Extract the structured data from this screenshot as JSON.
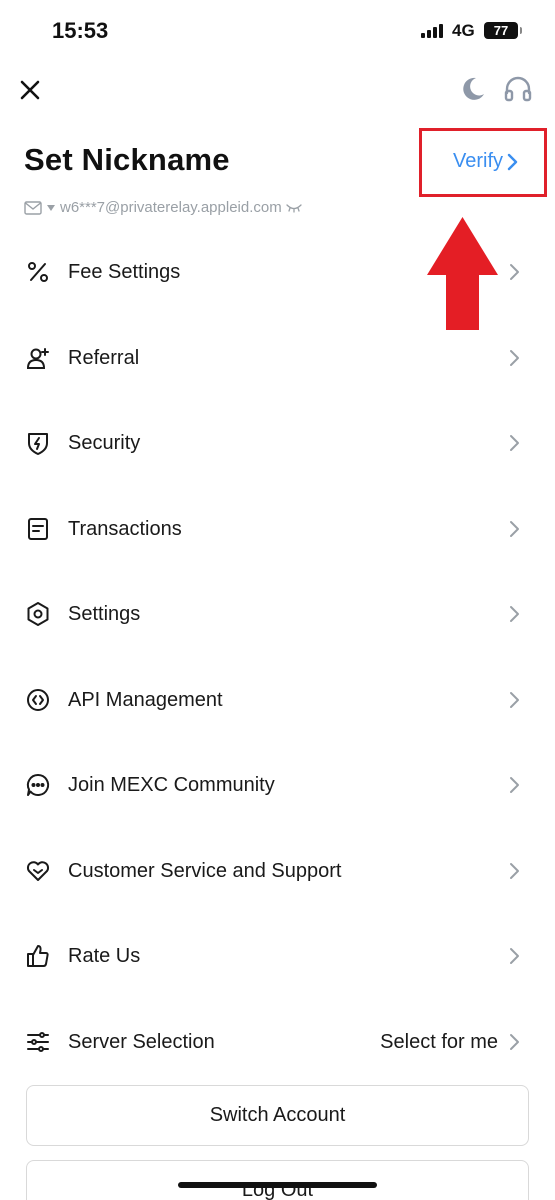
{
  "status_bar": {
    "time": "15:53",
    "network": "4G",
    "battery": "77"
  },
  "header": {
    "close_icon": "close-icon",
    "theme_icon": "moon-icon",
    "support_icon": "headset-icon"
  },
  "profile": {
    "title": "Set Nickname",
    "verify_label": "Verify",
    "email": "w6***7@privaterelay.appleid.com"
  },
  "menu": {
    "items": [
      {
        "label": "Fee Settings",
        "icon": "percent-icon"
      },
      {
        "label": "Referral",
        "icon": "add-user-icon"
      },
      {
        "label": "Security",
        "icon": "shield-icon"
      },
      {
        "label": "Transactions",
        "icon": "document-icon"
      },
      {
        "label": "Settings",
        "icon": "gear-icon"
      },
      {
        "label": "API Management",
        "icon": "api-icon"
      },
      {
        "label": "Join MEXC Community",
        "icon": "chat-icon"
      },
      {
        "label": "Customer Service and Support",
        "icon": "heart-icon"
      },
      {
        "label": "Rate Us",
        "icon": "thumbs-up-icon"
      },
      {
        "label": "Server Selection",
        "icon": "sliders-icon",
        "value": "Select for me"
      }
    ]
  },
  "buttons": {
    "switch_account": "Switch Account",
    "log_out": "Log Out"
  },
  "colors": {
    "accent": "#3a8ef0",
    "annotation": "#e0202a"
  }
}
